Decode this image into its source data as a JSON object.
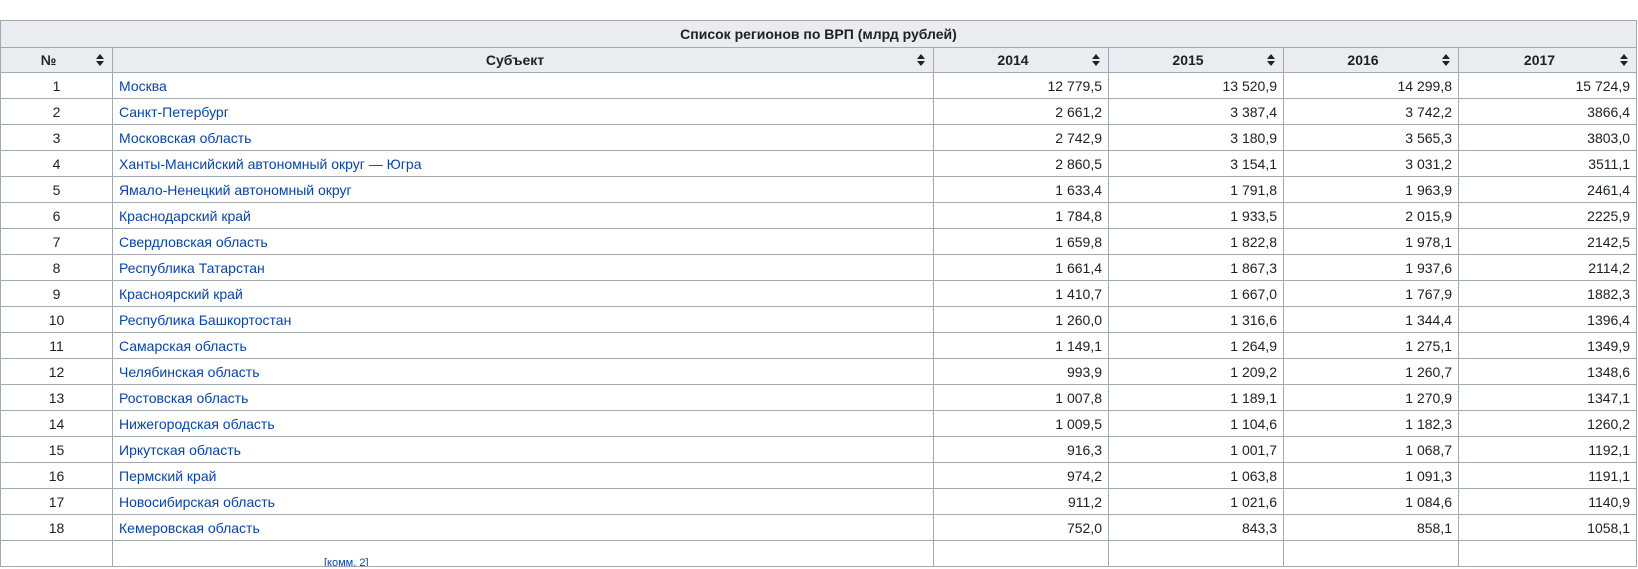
{
  "table": {
    "caption": "Список регионов по ВРП (млрд рублей)",
    "headers": {
      "num": "№",
      "subject": "Субъект",
      "y2014": "2014",
      "y2015": "2015",
      "y2016": "2016",
      "y2017": "2017"
    },
    "icons": {
      "sort": "sort-icon"
    },
    "colors": {
      "link": "#0645ad",
      "header_bg": "#eaecf0",
      "border": "#a2a9b1"
    },
    "rows": [
      {
        "num": "1",
        "subject": "Москва",
        "v2014": "12 779,5",
        "v2015": "13 520,9",
        "v2016": "14 299,8",
        "v2017": "15 724,9"
      },
      {
        "num": "2",
        "subject": "Санкт-Петербург",
        "v2014": "2 661,2",
        "v2015": "3 387,4",
        "v2016": "3 742,2",
        "v2017": "3866,4"
      },
      {
        "num": "3",
        "subject": "Московская область",
        "v2014": "2 742,9",
        "v2015": "3 180,9",
        "v2016": "3 565,3",
        "v2017": "3803,0"
      },
      {
        "num": "4",
        "subject": "Ханты-Мансийский автономный округ — Югра",
        "v2014": "2 860,5",
        "v2015": "3 154,1",
        "v2016": "3 031,2",
        "v2017": "3511,1"
      },
      {
        "num": "5",
        "subject": "Ямало-Ненецкий автономный округ",
        "v2014": "1 633,4",
        "v2015": "1 791,8",
        "v2016": "1 963,9",
        "v2017": "2461,4"
      },
      {
        "num": "6",
        "subject": "Краснодарский край",
        "v2014": "1 784,8",
        "v2015": "1 933,5",
        "v2016": "2 015,9",
        "v2017": "2225,9"
      },
      {
        "num": "7",
        "subject": "Свердловская область",
        "v2014": "1 659,8",
        "v2015": "1 822,8",
        "v2016": "1 978,1",
        "v2017": "2142,5"
      },
      {
        "num": "8",
        "subject": "Республика Татарстан",
        "v2014": "1 661,4",
        "v2015": "1 867,3",
        "v2016": "1 937,6",
        "v2017": "2114,2"
      },
      {
        "num": "9",
        "subject": "Красноярский край",
        "v2014": "1 410,7",
        "v2015": "1 667,0",
        "v2016": "1 767,9",
        "v2017": "1882,3"
      },
      {
        "num": "10",
        "subject": "Республика Башкортостан",
        "v2014": "1 260,0",
        "v2015": "1 316,6",
        "v2016": "1 344,4",
        "v2017": "1396,4"
      },
      {
        "num": "11",
        "subject": "Самарская область",
        "v2014": "1 149,1",
        "v2015": "1 264,9",
        "v2016": "1 275,1",
        "v2017": "1349,9"
      },
      {
        "num": "12",
        "subject": "Челябинская область",
        "v2014": "993,9",
        "v2015": "1 209,2",
        "v2016": "1 260,7",
        "v2017": "1348,6"
      },
      {
        "num": "13",
        "subject": "Ростовская область",
        "v2014": "1 007,8",
        "v2015": "1 189,1",
        "v2016": "1 270,9",
        "v2017": "1347,1"
      },
      {
        "num": "14",
        "subject": "Нижегородская область",
        "v2014": "1 009,5",
        "v2015": "1 104,6",
        "v2016": "1 182,3",
        "v2017": "1260,2"
      },
      {
        "num": "15",
        "subject": "Иркутская область",
        "v2014": "916,3",
        "v2015": "1 001,7",
        "v2016": "1 068,7",
        "v2017": "1192,1"
      },
      {
        "num": "16",
        "subject": "Пермский край",
        "v2014": "974,2",
        "v2015": "1 063,8",
        "v2016": "1 091,3",
        "v2017": "1191,1"
      },
      {
        "num": "17",
        "subject": "Новосибирская область",
        "v2014": "911,2",
        "v2015": "1 021,6",
        "v2016": "1 084,6",
        "v2017": "1140,9"
      },
      {
        "num": "18",
        "subject": "Кемеровская область",
        "v2014": "752,0",
        "v2015": "843,3",
        "v2016": "858,1",
        "v2017": "1058,1"
      }
    ],
    "partial_row_note": "[комм. 2]"
  }
}
